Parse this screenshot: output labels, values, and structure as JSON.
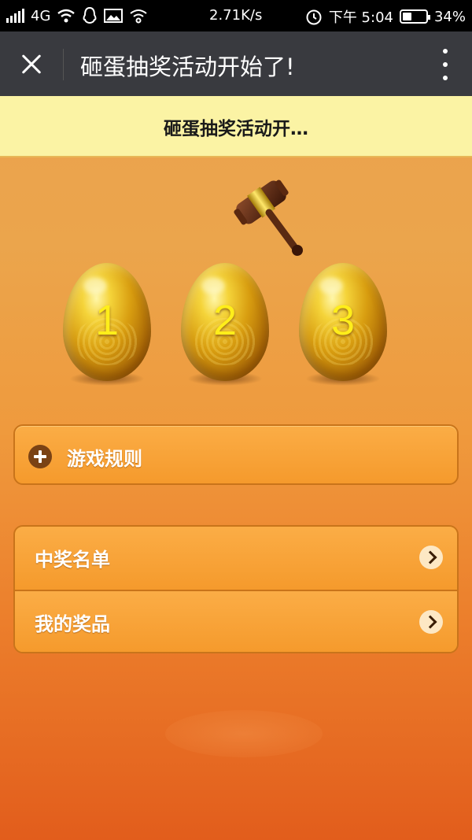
{
  "status_bar": {
    "network": "4G",
    "speed": "2.71K/s",
    "time": "下午 5:04",
    "battery": "34%",
    "battery_level": 0.34,
    "icons": [
      "signal-icon",
      "wifi-icon",
      "qq-icon",
      "image-icon",
      "hotspot-icon",
      "alarm-icon",
      "battery-icon"
    ]
  },
  "titlebar": {
    "title": "砸蛋抽奖活动开始了!",
    "icons": [
      "close-icon",
      "more-icon"
    ]
  },
  "banner": {
    "text": "砸蛋抽奖活动开…"
  },
  "eggs": [
    {
      "number": "1"
    },
    {
      "number": "2"
    },
    {
      "number": "3"
    }
  ],
  "rules": {
    "label": "游戏规则",
    "icon": "plus-icon"
  },
  "menu": {
    "items": [
      {
        "label": "中奖名单",
        "icon": "chevron-right-icon"
      },
      {
        "label": "我的奖品",
        "icon": "chevron-right-icon"
      }
    ]
  },
  "colors": {
    "titlebar_bg": "#393a3f",
    "banner_bg": "#fbf3a4",
    "panel_orange": "#f59a2c",
    "egg_number": "#ffee1a"
  }
}
